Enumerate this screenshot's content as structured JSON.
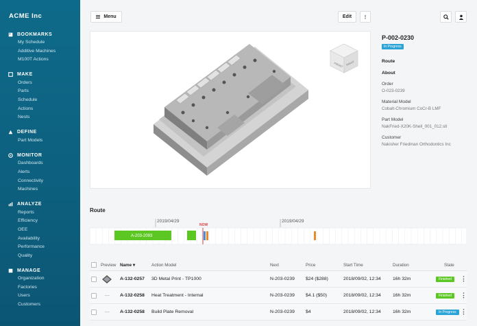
{
  "sidebar": {
    "brand": "ACME Inc",
    "sections": [
      {
        "title": "BOOKMARKS",
        "icon": "bookmark-icon",
        "items": [
          "My Schedule",
          "Additive Machines",
          "M100T Actions"
        ]
      },
      {
        "title": "MAKE",
        "icon": "make-icon",
        "items": [
          "Orders",
          "Parts",
          "Schedule",
          "Actions",
          "Nests"
        ]
      },
      {
        "title": "DEFINE",
        "icon": "define-icon",
        "items": [
          "Part Models"
        ]
      },
      {
        "title": "MONITOR",
        "icon": "monitor-icon",
        "items": [
          "Dashboards",
          "Alerts",
          "Connectivity",
          "Machines"
        ]
      },
      {
        "title": "ANALYZE",
        "icon": "analyze-icon",
        "items": [
          "Reports",
          "Efficiency",
          "OEE",
          "Availability",
          "Performance",
          "Quality"
        ]
      },
      {
        "title": "MANAGE",
        "icon": "manage-icon",
        "items": [
          "Organization",
          "Factories",
          "Users",
          "Customers"
        ]
      }
    ]
  },
  "toolbar": {
    "menu_label": "Menu",
    "edit_label": "Edit",
    "more_label": "⋮",
    "search_icon": "search-icon",
    "user_icon": "user-icon"
  },
  "part": {
    "number": "P-002-0230",
    "status": "In Progress",
    "nav": [
      "Route",
      "About"
    ],
    "fields": [
      {
        "label": "Order",
        "value": "O-023-0239"
      },
      {
        "label": "Material Model",
        "value": "Cobalt-Chromium CoCr-B LMF"
      },
      {
        "label": "Part Model",
        "value": "NakFried-X20K-Shell_001_012.stl"
      },
      {
        "label": "Customer",
        "value": "Nakisher Friedman Orthodontics Inc"
      }
    ]
  },
  "viewcube": {
    "front": "FRONT",
    "right": "RIGHT"
  },
  "route": {
    "title": "Route",
    "date_left": "2019/04/29",
    "date_right": "2019/04/29",
    "now_label": "NOW",
    "block_label": "A-203-2093",
    "colors": {
      "green": "#5cc723",
      "orange": "#e8892c",
      "blue": "#4a8fd4",
      "now": "#e0393e"
    }
  },
  "table": {
    "headers": {
      "preview": "Preview",
      "name": "Name",
      "action_model": "Action Model",
      "next": "Next",
      "price": "Price",
      "start_time": "Start Time",
      "duration": "Duration",
      "state": "State"
    },
    "rows": [
      {
        "name": "A-132-0257",
        "action_model": "3D Metal Print - TP1000",
        "next": "N-203-0239",
        "price": "$24 ($288)",
        "start_time": "2018/09/02, 12:34",
        "duration": "16h 32m",
        "state": "Finished",
        "state_color": "#5cc723",
        "has_preview": true
      },
      {
        "name": "A-132-0258",
        "action_model": "Heat Treatment - Internal",
        "next": "N-203-0239",
        "price": "$4.1 ($50)",
        "start_time": "2018/09/02, 12:34",
        "duration": "16h 32m",
        "state": "Finished",
        "state_color": "#5cc723",
        "has_preview": false
      },
      {
        "name": "A-132-0258",
        "action_model": "Build Plate Removal",
        "next": "N-203-0239",
        "price": "$4",
        "start_time": "2018/09/02, 12:34",
        "duration": "16h 32m",
        "state": "In Progress",
        "state_color": "#2aa3d6",
        "has_preview": false
      }
    ],
    "no_preview": "—"
  }
}
